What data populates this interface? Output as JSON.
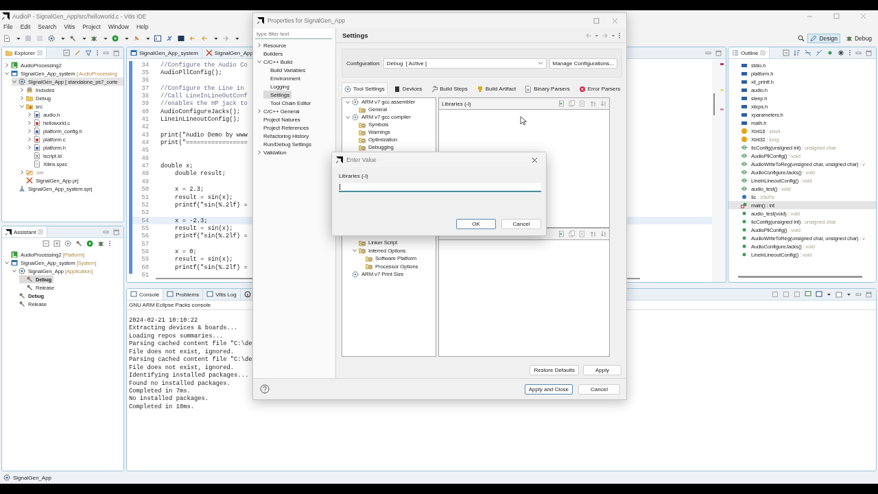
{
  "title_bar": {
    "title": "AudioP - SignalGen_App/src/helloworld.c - Vitis IDE"
  },
  "menu": [
    "File",
    "Edit",
    "Search",
    "Vitis",
    "Project",
    "Window",
    "Help"
  ],
  "perspectives": [
    {
      "label": "Design",
      "selected": true
    },
    {
      "label": "Debug",
      "selected": false
    }
  ],
  "explorer": {
    "title": "Explorer",
    "tree": [
      {
        "label": "AudioProcessing2",
        "kind": "platform",
        "expanded": false,
        "selected": false
      },
      {
        "label": "SignalGen_App_system",
        "suffix": "[ AudioProcessing",
        "kind": "system",
        "expanded": true,
        "selected": false,
        "children": [
          {
            "label": "SignalGen_App [ standalone_ps7_corte",
            "kind": "app",
            "expanded": true,
            "selected": true,
            "children": [
              {
                "label": "Includes",
                "kind": "includes",
                "expanded": false,
                "selected": false
              },
              {
                "label": "Debug",
                "kind": "folder",
                "expanded": false,
                "selected": false
              },
              {
                "label": "src",
                "kind": "src",
                "expanded": true,
                "selected": false,
                "children": [
                  {
                    "label": "audio.h",
                    "kind": "header",
                    "expanded": false,
                    "selected": false
                  },
                  {
                    "label": "helloworld.c",
                    "kind": "csource",
                    "expanded": false,
                    "selected": false
                  },
                  {
                    "label": "platform_config.h",
                    "kind": "header",
                    "expanded": false,
                    "selected": false
                  },
                  {
                    "label": "platform.c",
                    "kind": "csource",
                    "expanded": false,
                    "selected": false
                  },
                  {
                    "label": "platform.h",
                    "kind": "header",
                    "expanded": false,
                    "selected": false
                  },
                  {
                    "label": "lscript.ld",
                    "kind": "linker",
                    "selected": false
                  },
                  {
                    "label": "Xilinx.spec",
                    "kind": "spec",
                    "selected": false
                  }
                ]
              },
              {
                "label": ".ide",
                "kind": "ide",
                "expanded": false,
                "selected": false
              },
              {
                "label": "SignalGen_App.prj",
                "kind": "prj",
                "selected": false
              }
            ]
          },
          {
            "label": "SignalGen_App_system.sprj",
            "kind": "sprj",
            "selected": false
          }
        ]
      }
    ]
  },
  "assistant": {
    "title": "Assistant",
    "tree": [
      {
        "label": "AudioProcessing2",
        "suffix": "[Platform]",
        "kind": "platform",
        "selected": false
      },
      {
        "label": "SignalGen_App_system",
        "suffix": "[System]",
        "kind": "system",
        "expanded": true,
        "selected": false,
        "children": [
          {
            "label": "SignalGen_App",
            "suffix": "[Application]",
            "kind": "app",
            "expanded": true,
            "selected": false,
            "active": false,
            "children": [
              {
                "label": "Debug",
                "kind": "build",
                "selected": true,
                "active": true
              },
              {
                "label": "Release",
                "kind": "build",
                "selected": false,
                "active": false
              }
            ]
          },
          {
            "label": "Debug",
            "kind": "build",
            "selected": false,
            "active": true
          },
          {
            "label": "Release",
            "kind": "build",
            "selected": false,
            "active": false
          }
        ]
      }
    ]
  },
  "editor": {
    "tabs": [
      {
        "label": "SignalGen_App_system",
        "kind": "system"
      },
      {
        "label": "SignalGen_App",
        "kind": "prj"
      }
    ],
    "lines": [
      {
        "no": "34",
        "text": "//Configure the Audio Co",
        "kind": "comment",
        "current": false
      },
      {
        "no": "35",
        "text": "AudioPllConfig();",
        "kind": "code",
        "current": false
      },
      {
        "no": "36",
        "current": false
      },
      {
        "no": "37",
        "text": "//Configure the Line in",
        "kind": "comment",
        "current": false
      },
      {
        "no": "38",
        "text": "//Call LineInLineOutConf",
        "kind": "comment",
        "current": false
      },
      {
        "no": "39",
        "text": "//enables the HP jack to",
        "kind": "comment",
        "current": false
      },
      {
        "no": "40",
        "text": "AudioConfigureJacks();",
        "kind": "code",
        "current": false
      },
      {
        "no": "41",
        "text": "LineinLineoutConfig();",
        "kind": "code",
        "current": false
      },
      {
        "no": "42",
        "current": false
      },
      {
        "no": "43",
        "text": "print(\"Audio Demo by www",
        "kind": "code",
        "current": false
      },
      {
        "no": "44",
        "text": "print(\"=================",
        "kind": "code",
        "current": false
      },
      {
        "no": "45",
        "current": false
      },
      {
        "no": "46",
        "current": false
      },
      {
        "no": "47",
        "text": "double x;",
        "kind": "code",
        "current": false
      },
      {
        "no": "48",
        "text": "    double result;",
        "kind": "code",
        "current": false
      },
      {
        "no": "49",
        "current": false
      },
      {
        "no": "50",
        "text": "    x = 2.3;",
        "kind": "code",
        "current": false
      },
      {
        "no": "51",
        "text": "    result = sin(x);",
        "kind": "code",
        "current": false
      },
      {
        "no": "52",
        "text": "    printf(\"sin(%.2lf) =",
        "kind": "code",
        "current": false
      },
      {
        "no": "53",
        "current": false
      },
      {
        "no": "54",
        "text": "    x = -2.3;",
        "kind": "code",
        "current": true
      },
      {
        "no": "55",
        "text": "    result = sin(x);",
        "kind": "code",
        "current": false
      },
      {
        "no": "56",
        "text": "    printf(\"sin(%.2lf) =",
        "kind": "code",
        "current": false
      },
      {
        "no": "57",
        "current": false
      },
      {
        "no": "58",
        "text": "    x = 0;",
        "kind": "code",
        "current": false
      },
      {
        "no": "59",
        "text": "    result = sin(x);",
        "kind": "code",
        "current": false
      },
      {
        "no": "60",
        "text": "    printf(\"sin(%.2lf) =",
        "kind": "code",
        "current": false
      },
      {
        "no": "61",
        "current": false
      }
    ]
  },
  "console": {
    "tabs": [
      {
        "label": "Console",
        "selected": true
      },
      {
        "label": "Problems",
        "selected": false
      },
      {
        "label": "Vitis Log",
        "selected": false
      }
    ],
    "name": "GNU ARM Eclipse Packs console",
    "lines": [
      "2024-02-21 10:10:22",
      "Extracting devices & boards...",
      "Loading repos summaries...",
      "Parsing cached content file \"C:\\de",
      "File does not exist, ignored.",
      "Parsing cached content file \"C:\\de",
      "File does not exist, ignored.",
      "Identifying installed packages...",
      "Found no installed packages.",
      "Completed in 7ms.",
      "No installed packages.",
      "Completed in 10ms."
    ]
  },
  "outline": {
    "title": "Outline",
    "items": [
      {
        "name": "stdio.h",
        "kind": "include",
        "selected": false
      },
      {
        "name": "platform.h",
        "kind": "include",
        "selected": false
      },
      {
        "name": "xil_printf.h",
        "kind": "include",
        "selected": false
      },
      {
        "name": "audio.h",
        "kind": "include",
        "selected": false
      },
      {
        "name": "sleep.h",
        "kind": "include",
        "selected": false
      },
      {
        "name": "xiicps.h",
        "kind": "include",
        "selected": false
      },
      {
        "name": "xparameters.h",
        "kind": "include",
        "selected": false
      },
      {
        "name": "math.h",
        "kind": "include",
        "selected": false
      },
      {
        "name": "Xint16",
        "type": ": short",
        "kind": "typedef",
        "selected": false
      },
      {
        "name": "Xint32",
        "type": ": long",
        "kind": "typedef",
        "selected": false
      },
      {
        "name": "IicConfig(unsigned int)",
        "type": ": unsigned char",
        "kind": "declaration",
        "selected": false
      },
      {
        "name": "AudioPllConfig()",
        "type": ": void",
        "kind": "declaration",
        "selected": false
      },
      {
        "name": "AudioWriteToReg(unsigned char, unsigned char)",
        "type": ": v",
        "kind": "declaration",
        "selected": false
      },
      {
        "name": "AudioConfigureJacks()",
        "type": ": void",
        "kind": "declaration",
        "selected": false
      },
      {
        "name": "LineinLineoutConfig()",
        "type": ": void",
        "kind": "declaration",
        "selected": false
      },
      {
        "name": "audio_test()",
        "type": ": void",
        "kind": "declaration",
        "selected": false
      },
      {
        "name": "Iic",
        "type": ": XIicPs",
        "kind": "variable",
        "selected": false
      },
      {
        "name": "main()",
        "type": ": int",
        "kind": "main",
        "selected": true
      },
      {
        "name": "audio_test(void)",
        "type": ": void",
        "kind": "function",
        "selected": false
      },
      {
        "name": "IicConfig(unsigned int)",
        "type": ": unsigned char",
        "kind": "function",
        "selected": false
      },
      {
        "name": "AudioPllConfig()",
        "type": ": void",
        "kind": "function",
        "selected": false
      },
      {
        "name": "AudioWriteToReg(unsigned char, unsigned char)",
        "type": ": v",
        "kind": "function",
        "selected": false
      },
      {
        "name": "AudioConfigureJacks()",
        "type": ": void",
        "kind": "function",
        "selected": false
      },
      {
        "name": "LineinLineoutConfig()",
        "type": ": void",
        "kind": "function",
        "selected": false
      }
    ]
  },
  "status_bar": {
    "text": "SignalGen_App"
  },
  "properties_dialog": {
    "title": "Properties for SignalGen_App",
    "filter_placeholder": "type filter text",
    "nav": [
      {
        "label": "Resource",
        "expanded": false,
        "selected": false
      },
      {
        "label": "Builders",
        "selected": false
      },
      {
        "label": "C/C++ Build",
        "expanded": true,
        "selected": false,
        "children": [
          {
            "label": "Build Variables",
            "selected": false
          },
          {
            "label": "Environment",
            "selected": false
          },
          {
            "label": "Logging",
            "selected": false
          },
          {
            "label": "Settings",
            "selected": true
          },
          {
            "label": "Tool Chain Editor",
            "selected": false
          }
        ]
      },
      {
        "label": "C/C++ General",
        "expanded": false,
        "selected": false
      },
      {
        "label": "Project Natures",
        "selected": false
      },
      {
        "label": "Project References",
        "selected": false
      },
      {
        "label": "Refactoring History",
        "selected": false
      },
      {
        "label": "Run/Debug Settings",
        "selected": false
      },
      {
        "label": "Validation",
        "expanded": false,
        "selected": false
      }
    ],
    "heading": "Settings",
    "configuration": {
      "label": "Configuration:",
      "value": "Debug  [ Active ]"
    },
    "manage_button": "Manage Configurations...",
    "tabs": [
      {
        "label": "Tool Settings",
        "kind": "gear",
        "selected": true
      },
      {
        "label": "Devices",
        "kind": "chip",
        "selected": false
      },
      {
        "label": "Build Steps",
        "kind": "wrench",
        "selected": false
      },
      {
        "label": "Build Artifact",
        "kind": "trophy",
        "selected": false
      },
      {
        "label": "Binary Parsers",
        "kind": "document",
        "selected": false
      },
      {
        "label": "Error Parsers",
        "kind": "error",
        "selected": false
      }
    ],
    "tool_tree_upper": [
      {
        "label": "ARM v7 gcc assembler",
        "kind": "tool",
        "expanded": true,
        "children": [
          {
            "label": "General",
            "kind": "option"
          }
        ]
      },
      {
        "label": "ARM v7 gcc compiler",
        "kind": "tool",
        "expanded": true,
        "children": [
          {
            "label": "Symbols",
            "kind": "option"
          },
          {
            "label": "Warnings",
            "kind": "option"
          },
          {
            "label": "Optimization",
            "kind": "option"
          },
          {
            "label": "Debugging",
            "kind": "option"
          }
        ]
      }
    ],
    "tool_tree_lower": [
      {
        "children": [
          {
            "label": "Linker Script",
            "kind": "option"
          },
          {
            "label": "Inferred Options",
            "kind": "option",
            "expanded": true,
            "children": [
              {
                "label": "Software Platform",
                "kind": "option"
              },
              {
                "label": "Processor Options",
                "kind": "option"
              }
            ]
          }
        ]
      },
      {
        "label": "ARM v7 Print Size",
        "kind": "tool"
      }
    ],
    "libraries_pane": {
      "title": "Libraries (-l)"
    },
    "buttons": [
      "Restore Defaults",
      "Apply"
    ],
    "footer_buttons": [
      {
        "label": "Apply and Close",
        "default": true
      },
      {
        "label": "Cancel",
        "default": false
      }
    ]
  },
  "enter_value_dialog": {
    "title": "Enter Value",
    "label": "Libraries (-l)",
    "field": {
      "focused": true
    },
    "buttons": [
      {
        "label": "OK",
        "default": true
      },
      {
        "label": "Cancel",
        "default": false
      }
    ]
  }
}
